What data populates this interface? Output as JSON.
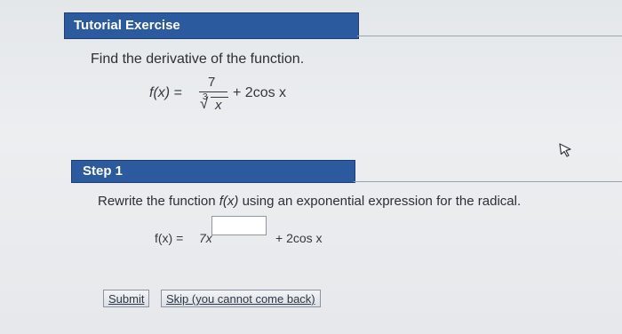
{
  "header": {
    "title": "Tutorial Exercise"
  },
  "question": {
    "prompt": "Find the derivative of the function.",
    "lhs": "f(x)",
    "equals": "=",
    "numerator": "7",
    "root_index": "3",
    "radical_sign": "√",
    "radicand": "x",
    "rest": "+ 2cos x"
  },
  "step": {
    "title": "Step 1",
    "instruction_pre": "Rewrite the function ",
    "instruction_fx": "f(x)",
    "instruction_post": " using an exponential expression for the radical.",
    "answer_lhs": "f(x)  =",
    "answer_coef": "7x",
    "exponent_value": "",
    "answer_rest": "+ 2cos x"
  },
  "buttons": {
    "submit": "Submit",
    "skip": "Skip (you cannot come back)"
  },
  "icons": {
    "cursor": "mouse-pointer-icon"
  },
  "colors": {
    "header_bg": "#2c5a9e",
    "page_bg": "#e8eaed"
  }
}
